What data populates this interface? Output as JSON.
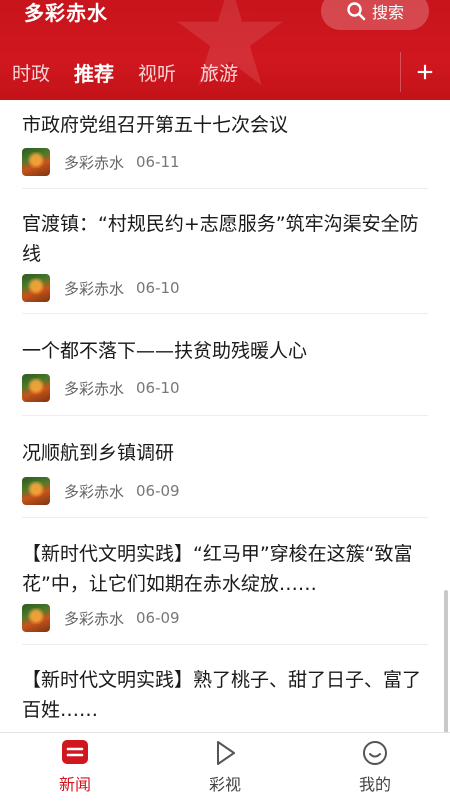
{
  "app": {
    "title": "多彩赤水",
    "search_label": "搜索"
  },
  "tabs": [
    {
      "label": "时政",
      "active": false
    },
    {
      "label": "推荐",
      "active": true
    },
    {
      "label": "视听",
      "active": false
    },
    {
      "label": "旅游",
      "active": false
    }
  ],
  "add_tab_icon": "plus-icon",
  "colors": {
    "brand_red": "#d0171f",
    "text_dark": "#1a1a1a",
    "text_gray": "#777777"
  },
  "feed": [
    {
      "title": "市政府党组召开第五十七次会议",
      "source": "多彩赤水",
      "date": "06-11"
    },
    {
      "title": "官渡镇：“村规民约+志愿服务”筑牢沟渠安全防线",
      "source": "多彩赤水",
      "date": "06-10"
    },
    {
      "title": "一个都不落下——扶贫助残暖人心",
      "source": "多彩赤水",
      "date": "06-10"
    },
    {
      "title": "况顺航到乡镇调研",
      "source": "多彩赤水",
      "date": "06-09"
    },
    {
      "title": "【新时代文明实践】“红马甲”穿梭在这簇“致富花”中，让它们如期在赤水绽放……",
      "source": "多彩赤水",
      "date": "06-09"
    },
    {
      "title": "【新时代文明实践】熟了桃子、甜了日子、富了百姓……",
      "source": "",
      "date": ""
    }
  ],
  "bottom_nav": [
    {
      "label": "新闻",
      "icon": "news-icon",
      "active": true
    },
    {
      "label": "彩视",
      "icon": "play-icon",
      "active": false
    },
    {
      "label": "我的",
      "icon": "smile-icon",
      "active": false
    }
  ]
}
